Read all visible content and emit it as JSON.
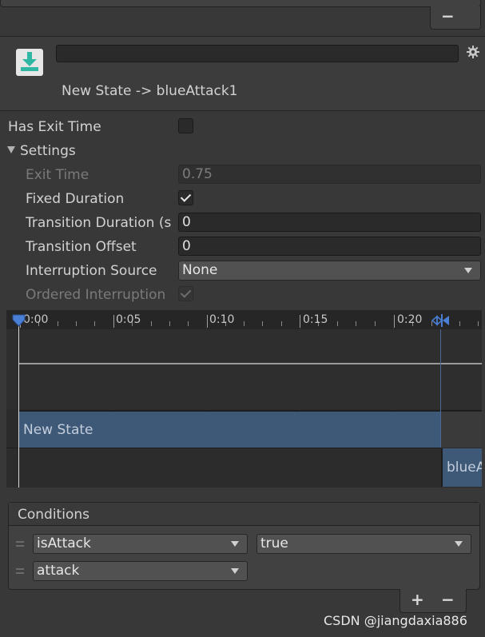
{
  "top_list": {
    "remove_icon_label": "−"
  },
  "header": {
    "name_value": "",
    "title": "New State -> blueAttack1"
  },
  "properties": {
    "has_exit_time_label": "Has Exit Time",
    "has_exit_time_checked": false,
    "settings_label": "Settings",
    "exit_time_label": "Exit Time",
    "exit_time_value": "0.75",
    "fixed_duration_label": "Fixed Duration",
    "fixed_duration_checked": true,
    "transition_duration_label": "Transition Duration (s",
    "transition_duration_value": "0",
    "transition_offset_label": "Transition Offset",
    "transition_offset_value": "0",
    "interruption_source_label": "Interruption Source",
    "interruption_source_value": "None",
    "ordered_interruption_label": "Ordered Interruption",
    "ordered_interruption_checked": true
  },
  "timeline": {
    "ticks": [
      "0:00",
      "0:05",
      "0:10",
      "0:15",
      "0:20"
    ],
    "source_state": "New State",
    "dest_state": "blueA"
  },
  "conditions": {
    "header": "Conditions",
    "rows": [
      {
        "parameter": "isAttack",
        "value": "true"
      },
      {
        "parameter": "attack"
      }
    ],
    "add_label": "+",
    "remove_label": "−"
  },
  "watermark": "CSDN @jiangdaxia886",
  "colors": {
    "state_bar": "#3e5877",
    "playhead": "#4a7fd6",
    "panel": "#383838"
  }
}
